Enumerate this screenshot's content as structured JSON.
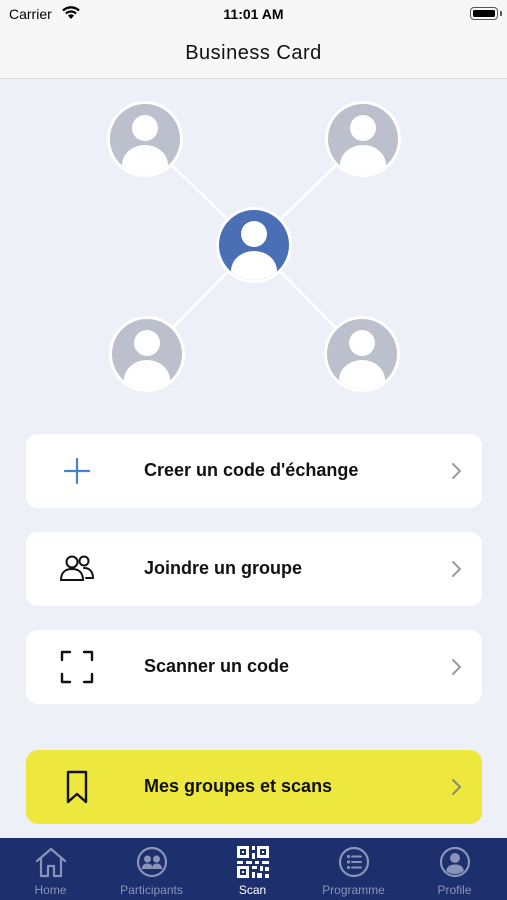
{
  "status_bar": {
    "carrier": "Carrier",
    "time": "11:01 AM"
  },
  "nav": {
    "title": "Business Card"
  },
  "network": {
    "center_color": "#4a6fb5",
    "node_color": "#bcbfcc",
    "line_color": "#ffffff"
  },
  "actions": [
    {
      "label": "Creer un code d'échange",
      "icon": "plus-icon"
    },
    {
      "label": "Joindre un groupe",
      "icon": "group-icon"
    },
    {
      "label": "Scanner un code",
      "icon": "scan-frame-icon"
    },
    {
      "label": "Mes groupes et scans",
      "icon": "bookmark-icon",
      "accent": "#eee83e"
    }
  ],
  "tabs": [
    {
      "label": "Home",
      "icon": "home-icon",
      "active": false
    },
    {
      "label": "Participants",
      "icon": "participants-icon",
      "active": false
    },
    {
      "label": "Scan",
      "icon": "qr-code-icon",
      "active": true
    },
    {
      "label": "Programme",
      "icon": "list-icon",
      "active": false
    },
    {
      "label": "Profile",
      "icon": "profile-icon",
      "active": false
    }
  ]
}
